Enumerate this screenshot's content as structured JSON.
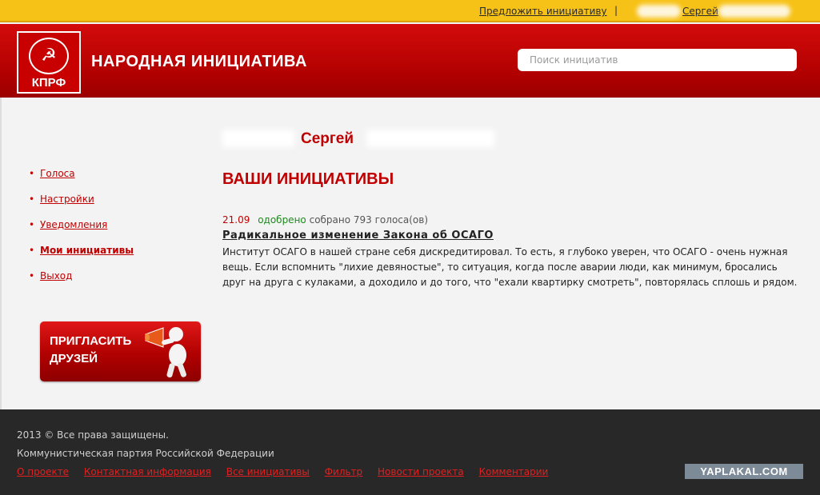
{
  "topbar": {
    "suggest_link": "Предложить инициативу",
    "separator": "|",
    "user_first_name": "Сергей"
  },
  "header": {
    "logo_text": "КПРФ",
    "site_title": "НАРОДНАЯ ИНИЦИАТИВА",
    "search_placeholder": "Поиск инициатив"
  },
  "sidebar": {
    "items": [
      {
        "label": "Голоса",
        "active": false
      },
      {
        "label": "Настройки",
        "active": false
      },
      {
        "label": "Уведомления",
        "active": false
      },
      {
        "label": "Мои инициативы",
        "active": true
      },
      {
        "label": "Выход",
        "active": false
      }
    ],
    "invite_button": "ПРИГЛАСИТЬ ДРУЗЕЙ"
  },
  "main": {
    "user_first_name": "Сергей",
    "section_title": "ВАШИ ИНИЦИАТИВЫ",
    "initiatives": [
      {
        "date": "21.09",
        "status": "одобрено",
        "votes_text": "собрано 793 голоса(ов)",
        "title": "Радикальное изменение Закона об ОСАГО",
        "text": "Институт ОСАГО в нашей стране себя дискредитировал. То есть, я глубоко уверен, что ОСАГО - очень нужная вещь. Если вспомнить \"лихие девяностые\", то ситуация, когда после аварии люди, как минимум, бросались друг на друга с кулаками, а доходило и до того, что \"ехали квартирку смотреть\", повторялась сплошь и рядом."
      }
    ]
  },
  "footer": {
    "copyright": "2013 © Все права защищены.",
    "party": "Коммунистическая партия Российской Федерации",
    "links": [
      "О проекте",
      "Контактная информация",
      "Все инициативы",
      "Фильтр",
      "Новости проекта",
      "Комментарии"
    ],
    "watermark": "YAPLAKAL.COM"
  },
  "colors": {
    "topbar": "#f7c217",
    "brand_red": "#c00000",
    "approved_green": "#1e8a1e",
    "footer_bg": "#282828"
  }
}
